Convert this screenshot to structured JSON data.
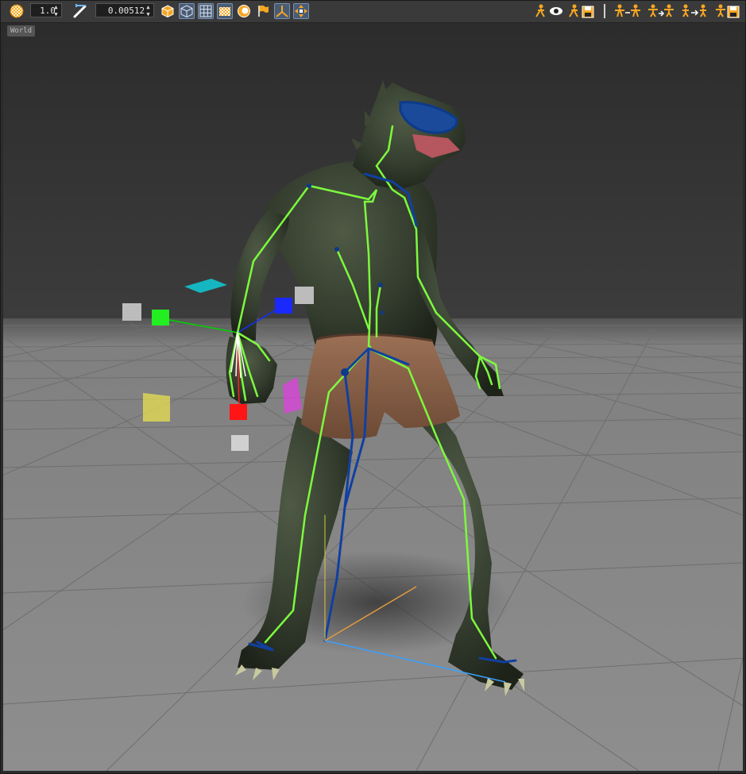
{
  "toolbar": {
    "left": {
      "sphere_icon": "sphere-texture-icon",
      "scale_value": "1.0",
      "measure_icon": "measure-tool-icon",
      "threshold_value": "0.00512",
      "view_buttons": [
        "solid-view-icon",
        "wireframe-view-icon",
        "grid-icon",
        "checker-icon",
        "lighting-icon",
        "flag-icon",
        "axis-icon",
        "move-icon"
      ]
    },
    "right": {
      "buttons": [
        "pose-visibility-icon",
        "pose-save-icon",
        "mirror-pose-icon",
        "retarget-pose-icon",
        "copy-pose-icon",
        "skeleton-save-icon"
      ]
    }
  },
  "viewport": {
    "space_label": "World"
  }
}
